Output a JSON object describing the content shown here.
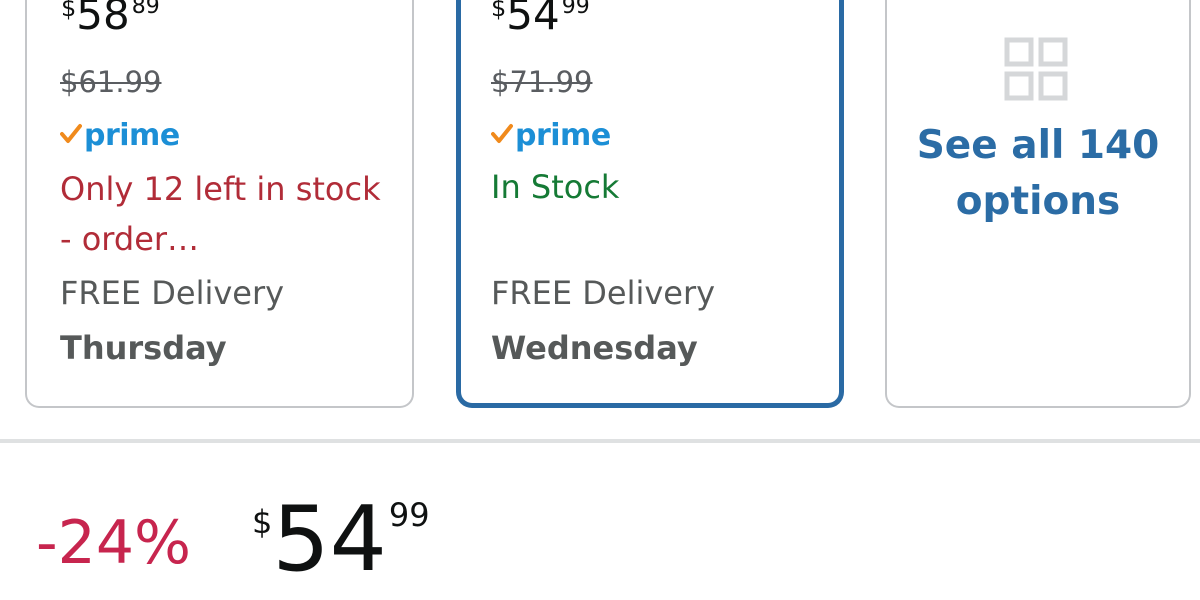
{
  "option_cards": [
    {
      "price_symbol": "$",
      "price_whole": "58",
      "price_fraction": "89",
      "list_price": "$61.99",
      "prime_label": "prime",
      "availability": "Only 12 left in stock - order…",
      "delivery_label": "FREE Delivery",
      "delivery_day": "Thursday",
      "selected": false
    },
    {
      "price_symbol": "$",
      "price_whole": "54",
      "price_fraction": "99",
      "list_price": "$71.99",
      "prime_label": "prime",
      "availability": "In Stock",
      "delivery_label": "FREE Delivery",
      "delivery_day": "Wednesday",
      "selected": true
    }
  ],
  "see_all": {
    "label": "See all 140 options",
    "icon": "grid-icon"
  },
  "summary": {
    "discount": "-24%",
    "price_symbol": "$",
    "price_whole": "54",
    "price_fraction": "99"
  },
  "colors": {
    "selected_border": "#2a6aa4",
    "prime_blue": "#1c8fd6",
    "prime_check": "#f08a1c",
    "low_stock_red": "#b12c38",
    "in_stock_green": "#157a35",
    "discount_red": "#c7254e",
    "link_blue": "#2b6ca5"
  }
}
